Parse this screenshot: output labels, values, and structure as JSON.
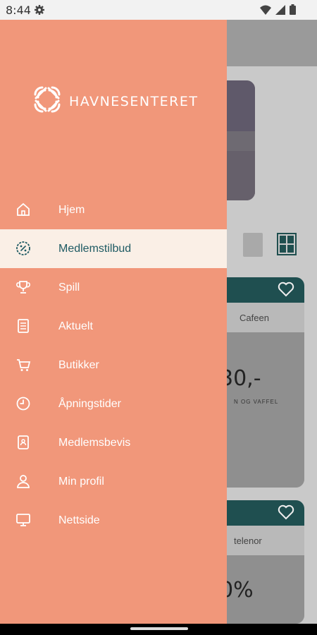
{
  "status_bar": {
    "time": "8:44"
  },
  "brand": {
    "name": "HAVNESENTERET"
  },
  "nav": {
    "items": [
      {
        "label": "Hjem",
        "icon": "home-icon"
      },
      {
        "label": "Medlemstilbud",
        "icon": "percent-badge-icon",
        "active": true
      },
      {
        "label": "Spill",
        "icon": "trophy-icon"
      },
      {
        "label": "Aktuelt",
        "icon": "news-icon"
      },
      {
        "label": "Butikker",
        "icon": "cart-icon"
      },
      {
        "label": "Åpningstider",
        "icon": "clock-icon"
      },
      {
        "label": "Medlemsbevis",
        "icon": "member-card-icon"
      },
      {
        "label": "Min profil",
        "icon": "user-icon"
      },
      {
        "label": "Nettside",
        "icon": "monitor-icon"
      }
    ]
  },
  "background": {
    "card1": {
      "pill": "art",
      "logo": "Cafeen",
      "price": "30,-",
      "caption": "N OG VAFFEL"
    },
    "card2": {
      "pill": "art",
      "logo": "telenor",
      "price": "0%"
    }
  },
  "colors": {
    "drawer": "#f1977a",
    "active_bg": "#faefe6",
    "active_text": "#1e5a63",
    "accent_dark": "#1f4f50"
  }
}
